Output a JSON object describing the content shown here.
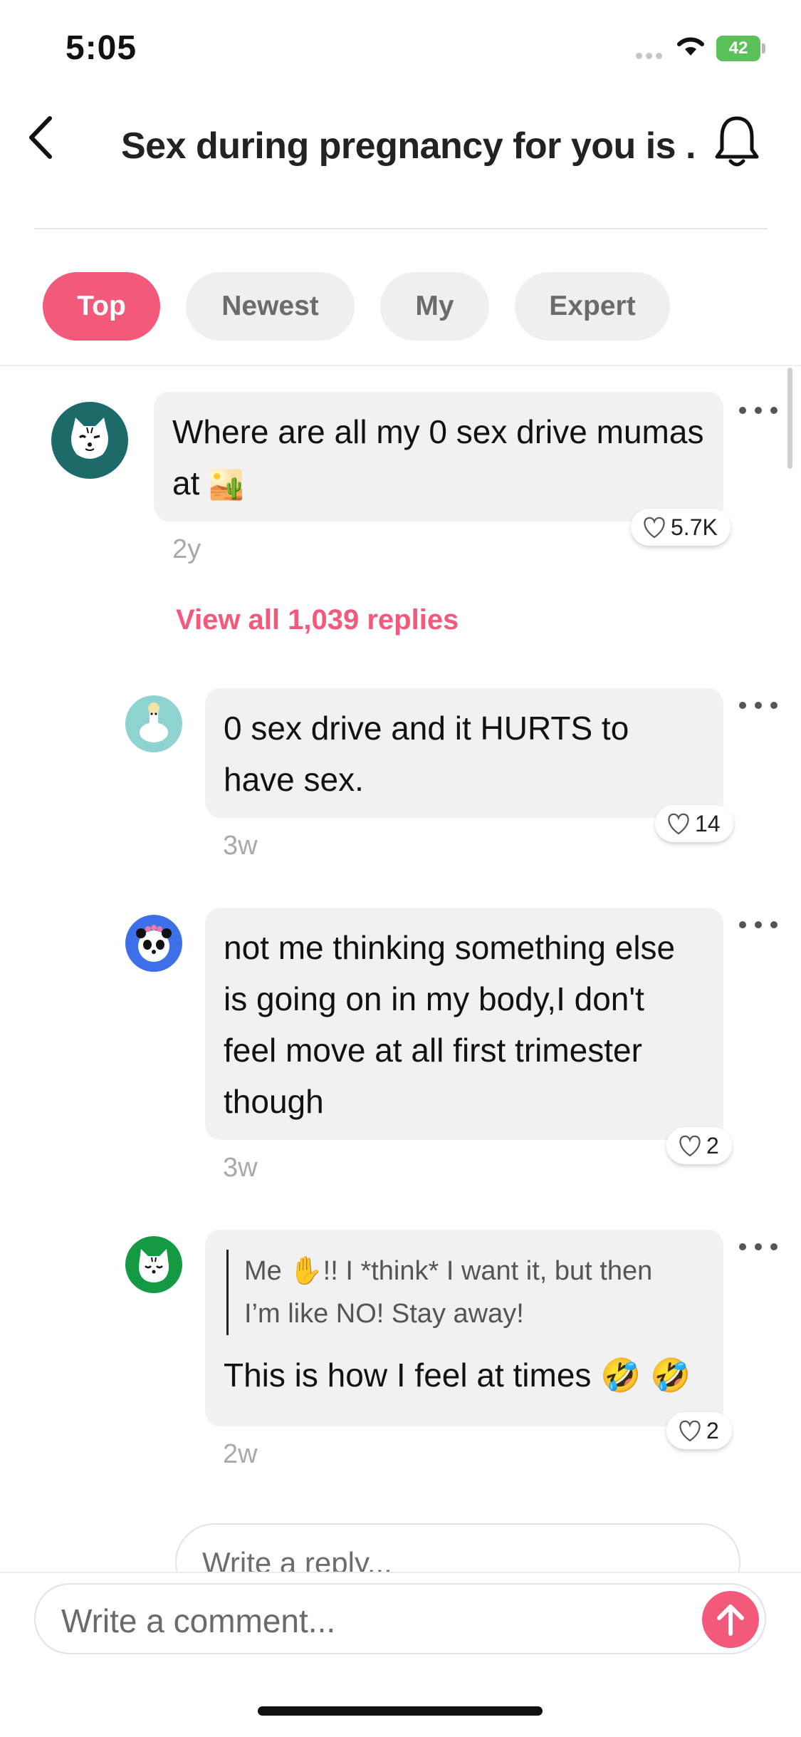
{
  "status_bar": {
    "time": "5:05",
    "battery": "42"
  },
  "header": {
    "title": "Sex during pregnancy for you is ..."
  },
  "tabs": [
    {
      "label": "Top",
      "active": true
    },
    {
      "label": "Newest",
      "active": false
    },
    {
      "label": "My",
      "active": false
    },
    {
      "label": "Expert",
      "active": false
    }
  ],
  "comments": [
    {
      "text": "Where are all my 0 sex drive mumas at 🏜️",
      "line1": "Where are all my 0 sex drive mumas",
      "line2": "at",
      "likes": "5.7K",
      "age": "2y",
      "view_replies": "View all 1,039 replies",
      "avatar": "cat-avatar-icon"
    }
  ],
  "replies": [
    {
      "lines": [
        "0 sex drive and it HURTS to",
        "have sex."
      ],
      "likes": "14",
      "age": "3w",
      "avatar": "llama-avatar-icon"
    },
    {
      "lines": [
        "not me thinking something else",
        "is going on in my body,I don't",
        "feel move at all first trimester",
        "though"
      ],
      "likes": "2",
      "age": "3w",
      "avatar": "panda-avatar-icon"
    },
    {
      "quote": [
        "Me ✋!! I *think* I want it, but then",
        "I’m like NO! Stay away!"
      ],
      "text": "This is how I feel at times 🤣 🤣",
      "likes": "2",
      "age": "2w",
      "avatar": "tiger-avatar-icon"
    }
  ],
  "reply_input": {
    "placeholder": "Write a reply..."
  },
  "comment_input": {
    "placeholder": "Write a comment..."
  },
  "colors": {
    "accent": "#f2597a",
    "bubble": "#f1f1f1",
    "tab_inactive": "#efefef"
  }
}
